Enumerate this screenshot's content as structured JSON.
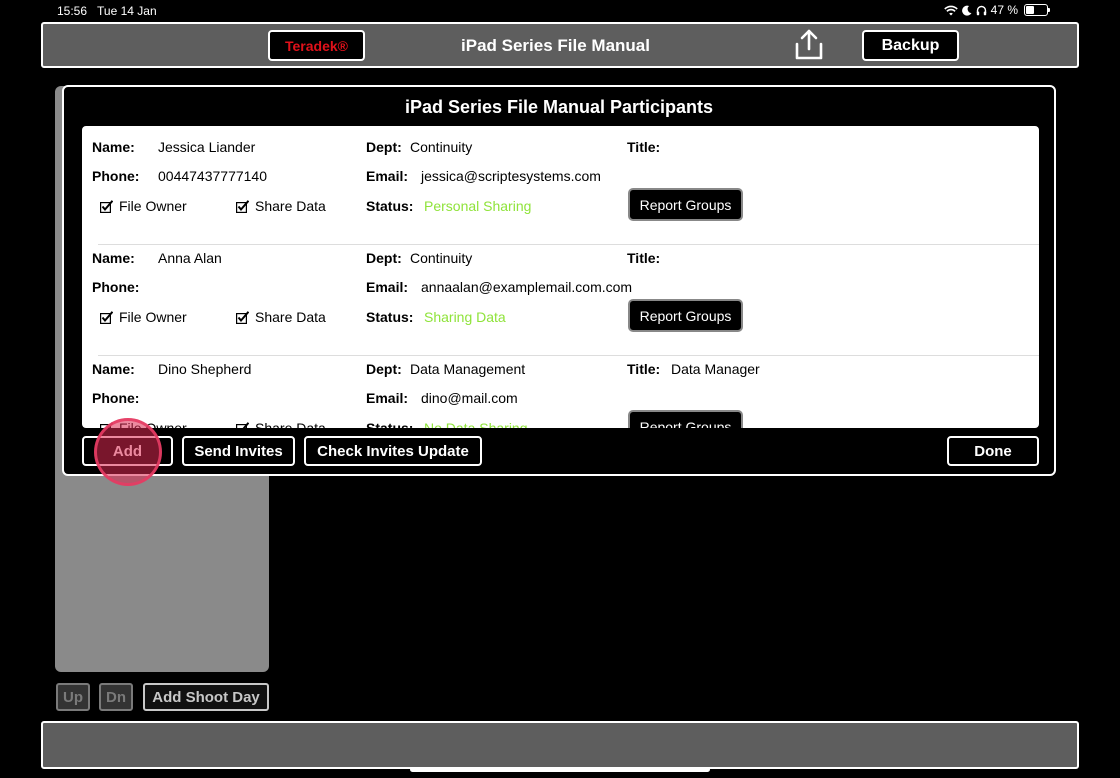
{
  "status_bar": {
    "time": "15:56",
    "date": "Tue 14 Jan",
    "battery": "47 %",
    "battery_level": 0.47
  },
  "toolbar": {
    "brand": "Teradek®",
    "title": "iPad Series File Manual",
    "backup_label": "Backup",
    "share_icon": "share-icon"
  },
  "left_panel": {
    "up_label": "Up",
    "dn_label": "Dn",
    "add_shoot_day_label": "Add Shoot Day"
  },
  "modal": {
    "title": "iPad Series File Manual Participants",
    "labels": {
      "name": "Name:",
      "phone": "Phone:",
      "dept": "Dept:",
      "email": "Email:",
      "status": "Status:",
      "title": "Title:",
      "file_owner": "File Owner",
      "share_data": "Share Data",
      "report_groups": "Report Groups"
    },
    "participants": [
      {
        "name": "Jessica Liander",
        "phone": "00447437777140",
        "dept": "Continuity",
        "email": "jessica@scriptesystems.com",
        "status": "Personal Sharing",
        "title": "",
        "file_owner": true,
        "share_data": true
      },
      {
        "name": "Anna Alan",
        "phone": "",
        "dept": "Continuity",
        "email": "annaalan@examplemail.com.com",
        "status": "Sharing Data",
        "title": "",
        "file_owner": true,
        "share_data": true
      },
      {
        "name": "Dino Shepherd",
        "phone": "",
        "dept": "Data Management",
        "email": "dino@mail.com",
        "status": "No Data Sharing",
        "title": "Data Manager",
        "file_owner": false,
        "share_data": false
      }
    ],
    "buttons": {
      "add": "Add",
      "send_invites": "Send Invites",
      "check_invites": "Check Invites Update",
      "done": "Done"
    }
  },
  "colors": {
    "accent_status": "#8fe33a",
    "brand_red": "#e0111a",
    "toolbar_grey": "#5e5e5e",
    "touch_indicator": "#dc2850"
  }
}
